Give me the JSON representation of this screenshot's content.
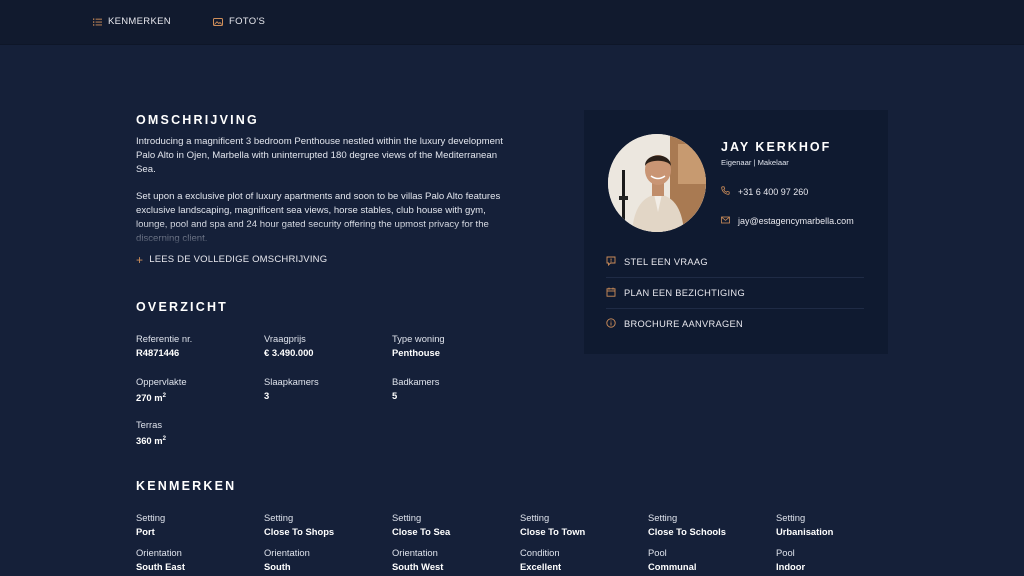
{
  "nav": {
    "items": [
      {
        "label": "KENMERKEN",
        "icon": "list-icon"
      },
      {
        "label": "FOTO'S",
        "icon": "photos-icon"
      }
    ]
  },
  "description": {
    "title": "OMSCHRIJVING",
    "paragraph_1": "Introducing a magnificent 3 bedroom Penthouse nestled within the luxury development Palo Alto in Ojen, Marbella with uninterrupted 180 degree views of the Mediterranean Sea.",
    "paragraph_2": "Set upon a exclusive plot of luxury apartments and soon to be villas Palo Alto features exclusive landscaping, magnificent sea views, horse stables, club house with gym, lounge, pool and spa and 24 hour gated security offering the upmost privacy for the discerning client.",
    "read_more": "LEES DE VOLLEDIGE OMSCHRIJVING"
  },
  "overview": {
    "title": "OVERZICHT",
    "fields": [
      {
        "label": "Referentie nr.",
        "value": "R4871446"
      },
      {
        "label": "Vraagprijs",
        "value": "€ 3.490.000"
      },
      {
        "label": "Type woning",
        "value": "Penthouse"
      },
      {
        "label": "Oppervlakte",
        "value": "270 m",
        "unit": "2"
      },
      {
        "label": "Slaapkamers",
        "value": "3"
      },
      {
        "label": "Badkamers",
        "value": "5"
      },
      {
        "label": "Terras",
        "value": "360 m",
        "unit": "2"
      }
    ]
  },
  "features": {
    "title": "KENMERKEN",
    "items": [
      {
        "label": "Setting",
        "value": "Port"
      },
      {
        "label": "Setting",
        "value": "Close To Shops"
      },
      {
        "label": "Setting",
        "value": "Close To Sea"
      },
      {
        "label": "Setting",
        "value": "Close To Town"
      },
      {
        "label": "Setting",
        "value": "Close To Schools"
      },
      {
        "label": "Setting",
        "value": "Urbanisation"
      },
      {
        "label": "Orientation",
        "value": "South East"
      },
      {
        "label": "Orientation",
        "value": "South"
      },
      {
        "label": "Orientation",
        "value": "South West"
      },
      {
        "label": "Condition",
        "value": "Excellent"
      },
      {
        "label": "Pool",
        "value": "Communal"
      },
      {
        "label": "Pool",
        "value": "Indoor"
      }
    ]
  },
  "agent": {
    "name": "JAY KERKHOF",
    "role": "Eigenaar | Makelaar",
    "phone": "+31 6 400 97 260",
    "email": "jay@estagencymarbella.com",
    "actions": [
      {
        "label": "STEL EEN VRAAG",
        "icon": "question-bubble-icon"
      },
      {
        "label": "PLAN EEN BEZICHTIGING",
        "icon": "calendar-icon"
      },
      {
        "label": "BROCHURE AANVRAGEN",
        "icon": "info-icon"
      }
    ]
  },
  "colors": {
    "background": "#152039",
    "topbar": "#111a2e",
    "card": "#0f1a30",
    "accent": "#d08f5a"
  }
}
